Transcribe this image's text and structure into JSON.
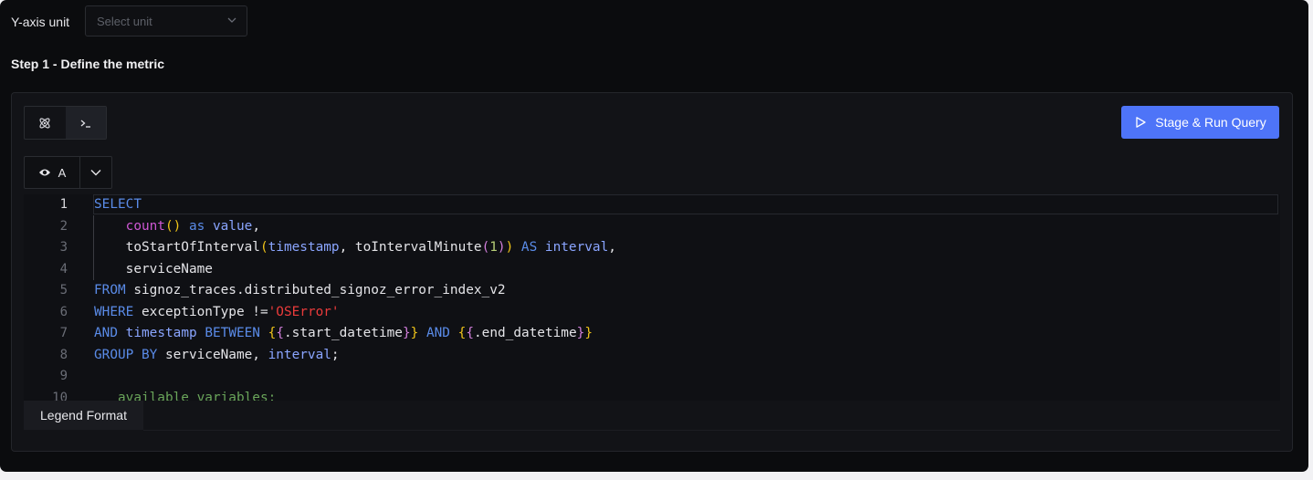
{
  "unit": {
    "label": "Y-axis unit",
    "placeholder": "Select unit"
  },
  "step": {
    "title": "Step 1 - Define the metric"
  },
  "run_button": {
    "label": "Stage & Run Query"
  },
  "query": {
    "name": "A"
  },
  "editor": {
    "line_numbers": [
      "1",
      "2",
      "3",
      "4",
      "5",
      "6",
      "7",
      "8",
      "9",
      "10"
    ],
    "lines": [
      [
        {
          "t": "kw",
          "v": "SELECT"
        }
      ],
      [
        {
          "t": "p",
          "v": "    "
        },
        {
          "t": "fn",
          "v": "count"
        },
        {
          "t": "br",
          "v": "()"
        },
        {
          "t": "p",
          "v": " "
        },
        {
          "t": "kw",
          "v": "as"
        },
        {
          "t": "p",
          "v": " "
        },
        {
          "t": "col",
          "v": "value"
        },
        {
          "t": "p",
          "v": ","
        }
      ],
      [
        {
          "t": "p",
          "v": "    toStartOfInterval"
        },
        {
          "t": "br",
          "v": "("
        },
        {
          "t": "col",
          "v": "timestamp"
        },
        {
          "t": "p",
          "v": ", toIntervalMinute"
        },
        {
          "t": "br2",
          "v": "("
        },
        {
          "t": "num",
          "v": "1"
        },
        {
          "t": "br2",
          "v": ")"
        },
        {
          "t": "br",
          "v": ")"
        },
        {
          "t": "p",
          "v": " "
        },
        {
          "t": "kw",
          "v": "AS"
        },
        {
          "t": "p",
          "v": " "
        },
        {
          "t": "col",
          "v": "interval"
        },
        {
          "t": "p",
          "v": ","
        }
      ],
      [
        {
          "t": "p",
          "v": "    serviceName"
        }
      ],
      [
        {
          "t": "kw",
          "v": "FROM"
        },
        {
          "t": "p",
          "v": " signoz_traces.distributed_signoz_error_index_v2"
        }
      ],
      [
        {
          "t": "kw",
          "v": "WHERE"
        },
        {
          "t": "p",
          "v": " exceptionType !="
        },
        {
          "t": "str",
          "v": "'OSError'"
        }
      ],
      [
        {
          "t": "kw",
          "v": "AND"
        },
        {
          "t": "p",
          "v": " "
        },
        {
          "t": "col",
          "v": "timestamp"
        },
        {
          "t": "p",
          "v": " "
        },
        {
          "t": "kw",
          "v": "BETWEEN"
        },
        {
          "t": "p",
          "v": " "
        },
        {
          "t": "br",
          "v": "{"
        },
        {
          "t": "br2",
          "v": "{"
        },
        {
          "t": "p",
          "v": ".start_datetime"
        },
        {
          "t": "br2",
          "v": "}"
        },
        {
          "t": "br",
          "v": "}"
        },
        {
          "t": "p",
          "v": " "
        },
        {
          "t": "kw",
          "v": "AND"
        },
        {
          "t": "p",
          "v": " "
        },
        {
          "t": "br",
          "v": "{"
        },
        {
          "t": "br2",
          "v": "{"
        },
        {
          "t": "p",
          "v": ".end_datetime"
        },
        {
          "t": "br2",
          "v": "}"
        },
        {
          "t": "br",
          "v": "}"
        }
      ],
      [
        {
          "t": "kw",
          "v": "GROUP BY"
        },
        {
          "t": "p",
          "v": " serviceName, "
        },
        {
          "t": "col",
          "v": "interval"
        },
        {
          "t": "p",
          "v": ";"
        }
      ],
      [
        {
          "t": "p",
          "v": ""
        }
      ],
      [
        {
          "t": "cm",
          "v": "   available variables:"
        }
      ]
    ]
  },
  "legend": {
    "label": "Legend Format"
  },
  "icons": {
    "builder": "atom-icon",
    "code": "terminal-icon",
    "run": "play-icon",
    "visibility": "eye-icon",
    "collapse": "chevron-down-icon",
    "select": "chevron-down-icon"
  },
  "colors": {
    "accent": "#4e74f8",
    "background": "#0b0c0e"
  }
}
